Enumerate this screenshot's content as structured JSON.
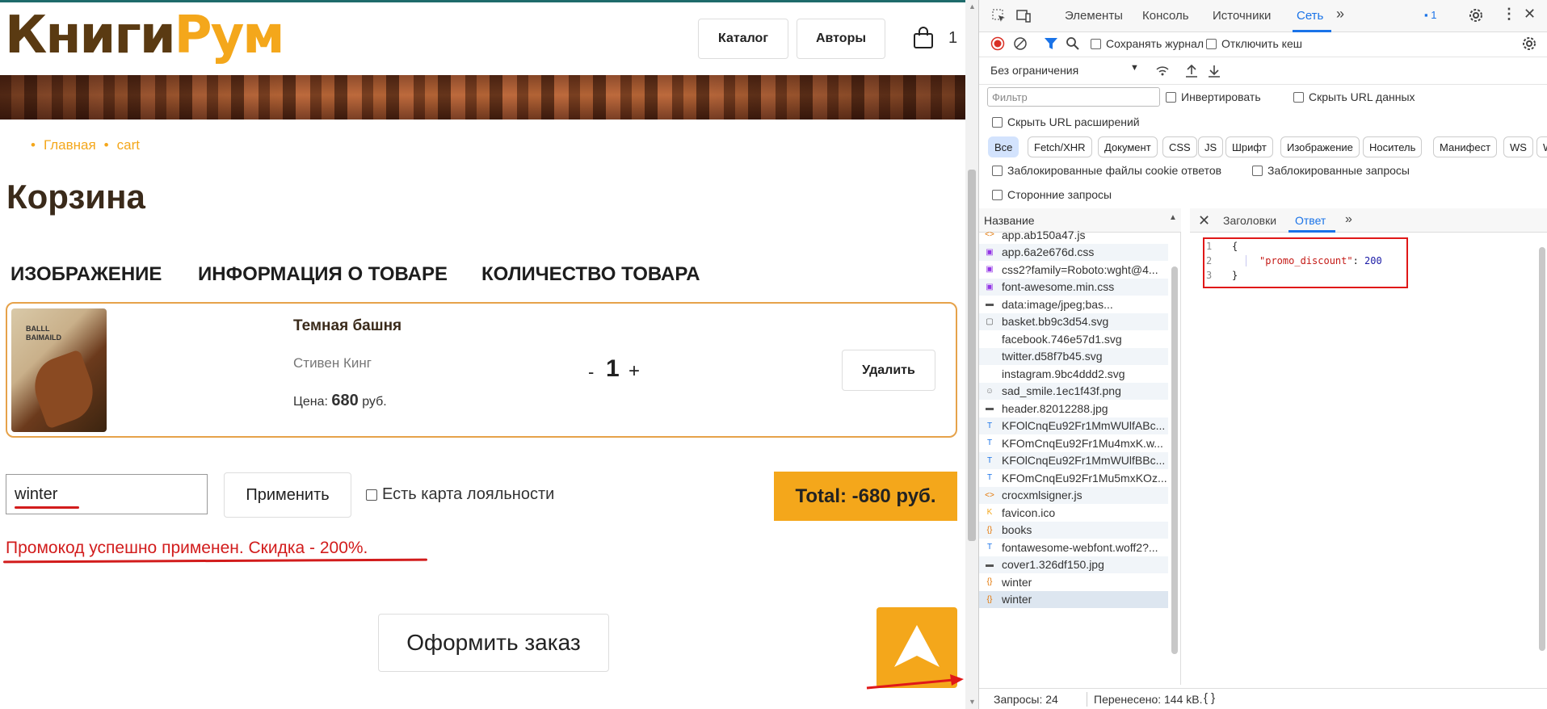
{
  "site": {
    "logo_part1": "Книги",
    "logo_part2": "Рум",
    "nav": {
      "catalog": "Каталог",
      "authors": "Авторы"
    },
    "cart_count": "1",
    "breadcrumb": [
      "Главная",
      "cart"
    ],
    "page_title": "Корзина",
    "columns": [
      "ИЗОБРАЖЕНИЕ",
      "ИНФОРМАЦИЯ О ТОВАРЕ",
      "КОЛИЧЕСТВО ТОВАРА"
    ],
    "cart_item": {
      "title": "Темная башня",
      "author": "Стивен Кинг",
      "price_label": "Цена:",
      "price_value": "680",
      "price_currency": "руб.",
      "qty_minus": "-",
      "qty": "1",
      "qty_plus": "+",
      "delete_label": "Удалить",
      "cover_text_line1": "BALLL",
      "cover_text_line2": "BAIMAILD"
    },
    "promo": {
      "input_value": "winter",
      "apply_label": "Применить",
      "loyalty_label": "Есть карта лояльности",
      "success_message": "Промокод успешно применен. Скидка - 200%."
    },
    "total_label": "Total: -680 руб.",
    "checkout_label": "Оформить заказ",
    "colors": {
      "accent": "#f4a71b",
      "brand_dark": "#5a3a12",
      "error": "#d21c1c"
    }
  },
  "devtools": {
    "tabs": [
      "Элементы",
      "Консоль",
      "Источники",
      "Сеть"
    ],
    "active_tab": "Сеть",
    "issues_count": "1",
    "toolbar": {
      "preserve_log": "Сохранять журнал",
      "disable_cache": "Отключить кеш",
      "throttling": "Без ограничения"
    },
    "filter": {
      "placeholder": "Фильтр",
      "invert": "Инвертировать",
      "hide_data_urls": "Скрыть URL данных",
      "hide_ext_urls": "Скрыть URL расширений",
      "blocked_cookies": "Заблокированные файлы cookie ответов",
      "blocked_requests": "Заблокированные запросы",
      "third_party": "Сторонние запросы"
    },
    "type_chips": [
      "Все",
      "Fetch/XHR",
      "Документ",
      "CSS",
      "JS",
      "Шрифт",
      "Изображение",
      "Носитель",
      "Манифест",
      "WS",
      "W"
    ],
    "list_header": "Название",
    "requests": [
      {
        "name": "app.ab150a47.js",
        "icon": "js-icon"
      },
      {
        "name": "app.6a2e676d.css",
        "icon": "css-icon"
      },
      {
        "name": "css2?family=Roboto:wght@4...",
        "icon": "css-icon"
      },
      {
        "name": "font-awesome.min.css",
        "icon": "css-icon"
      },
      {
        "name": "data:image/jpeg;bas...",
        "icon": "image-icon"
      },
      {
        "name": "basket.bb9c3d54.svg",
        "icon": "basket-icon"
      },
      {
        "name": "facebook.746e57d1.svg",
        "icon": "blank-icon"
      },
      {
        "name": "twitter.d58f7b45.svg",
        "icon": "blank-icon"
      },
      {
        "name": "instagram.9bc4ddd2.svg",
        "icon": "blank-icon"
      },
      {
        "name": "sad_smile.1ec1f43f.png",
        "icon": "smile-icon"
      },
      {
        "name": "header.82012288.jpg",
        "icon": "image-icon"
      },
      {
        "name": "KFOlCnqEu92Fr1MmWUlfABc...",
        "icon": "font-icon"
      },
      {
        "name": "KFOmCnqEu92Fr1Mu4mxK.w...",
        "icon": "font-icon"
      },
      {
        "name": "KFOlCnqEu92Fr1MmWUlfBBc...",
        "icon": "font-icon"
      },
      {
        "name": "KFOmCnqEu92Fr1Mu5mxKOz...",
        "icon": "font-icon"
      },
      {
        "name": "crocxmlsigner.js",
        "icon": "js-icon"
      },
      {
        "name": "favicon.ico",
        "icon": "favicon-icon"
      },
      {
        "name": "books",
        "icon": "fetch-icon"
      },
      {
        "name": "fontawesome-webfont.woff2?...",
        "icon": "font-icon"
      },
      {
        "name": "cover1.326df150.jpg",
        "icon": "image-icon"
      },
      {
        "name": "winter",
        "icon": "fetch-icon"
      },
      {
        "name": "winter",
        "icon": "fetch-icon"
      }
    ],
    "detail_tabs": {
      "headers": "Заголовки",
      "response": "Ответ"
    },
    "response_lines": [
      {
        "num": "1",
        "text": "{"
      },
      {
        "num": "2",
        "key": "\"promo_discount\"",
        "sep": ": ",
        "value": "200"
      },
      {
        "num": "3",
        "text": "}"
      }
    ],
    "status": {
      "requests": "Запросы: 24",
      "transferred": "Перенесено: 144 kB."
    }
  }
}
